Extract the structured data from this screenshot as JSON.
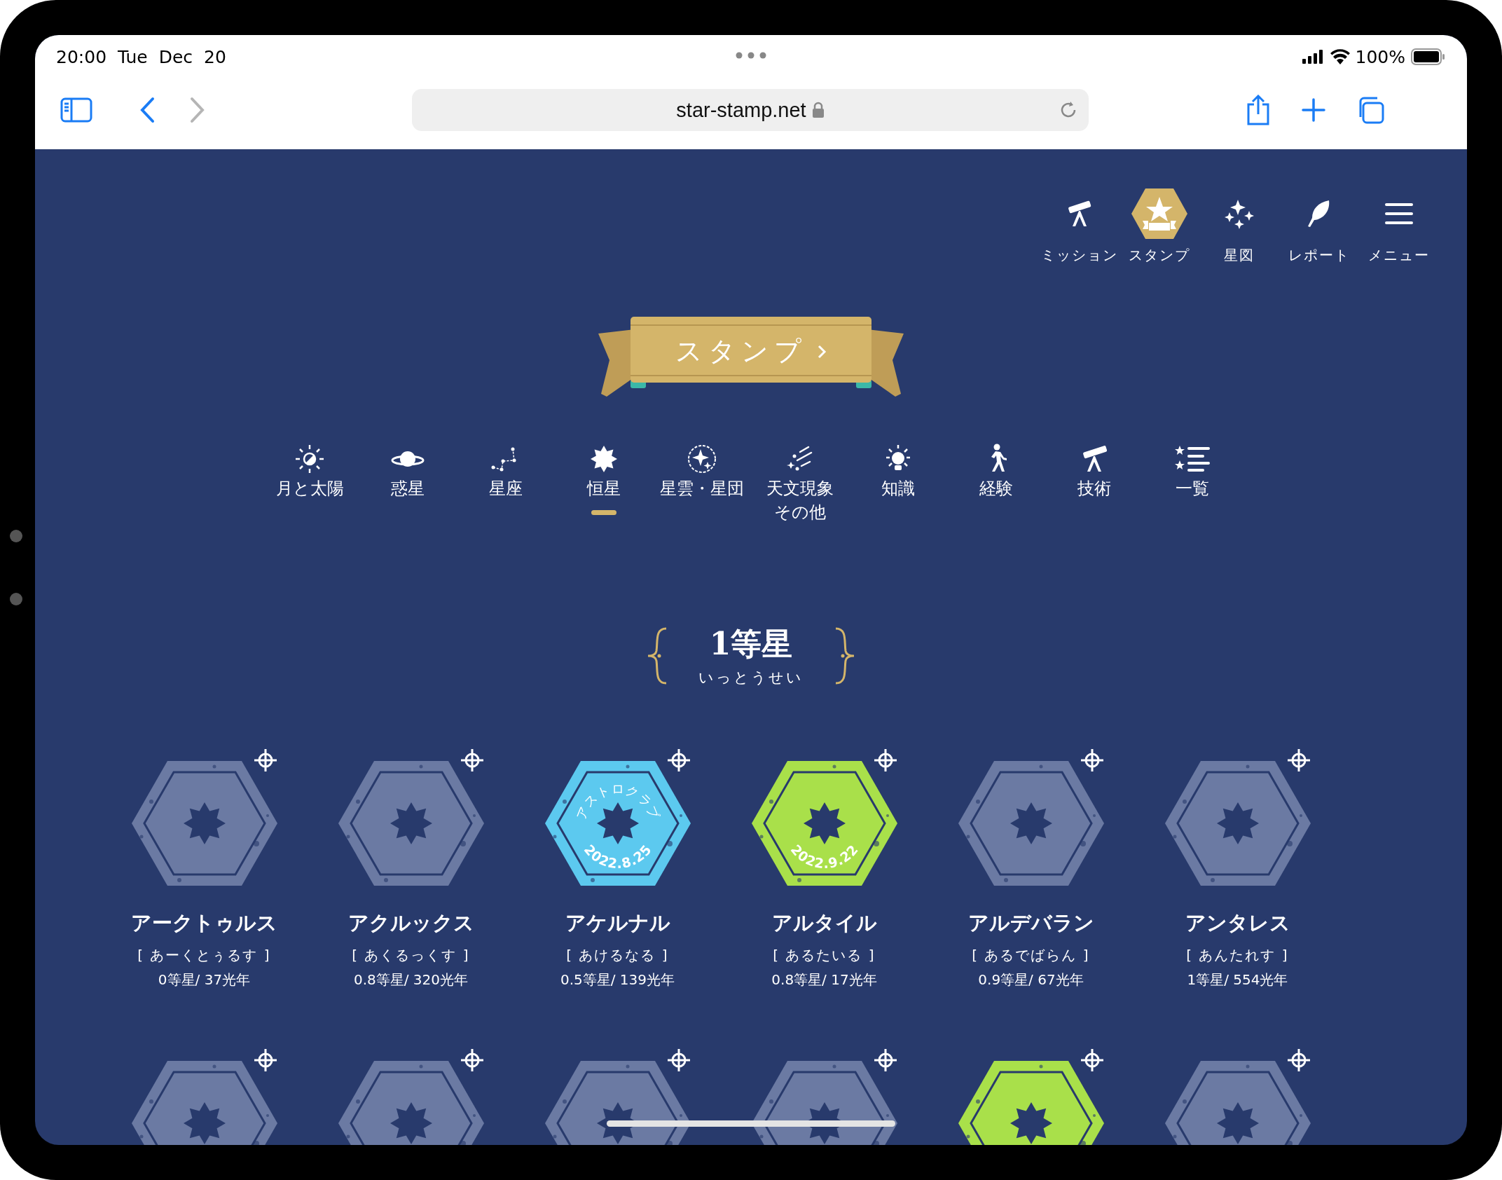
{
  "status_bar": {
    "time": "20:00",
    "date": "Tue Dec 20",
    "battery": "100%"
  },
  "browser": {
    "url": "star-stamp.net",
    "forward_enabled": false
  },
  "top_nav": [
    {
      "label": "ミッション",
      "selected": false
    },
    {
      "label": "スタンプ",
      "selected": true
    },
    {
      "label": "星図",
      "selected": false
    },
    {
      "label": "レポート",
      "selected": false
    },
    {
      "label": "メニュー",
      "selected": false
    }
  ],
  "banner": {
    "label": "スタンプ"
  },
  "categories": [
    {
      "lines": [
        "月と太陽"
      ],
      "selected": false
    },
    {
      "lines": [
        "惑星"
      ],
      "selected": false
    },
    {
      "lines": [
        "星座"
      ],
      "selected": false
    },
    {
      "lines": [
        "恒星"
      ],
      "selected": true
    },
    {
      "lines": [
        "星雲・星団"
      ],
      "selected": false
    },
    {
      "lines": [
        "天文現象",
        "その他"
      ],
      "selected": false
    },
    {
      "lines": [
        "知識"
      ],
      "selected": false
    },
    {
      "lines": [
        "経験"
      ],
      "selected": false
    },
    {
      "lines": [
        "技術"
      ],
      "selected": false
    },
    {
      "lines": [
        "一覧"
      ],
      "selected": false
    }
  ],
  "section": {
    "title": "1等星",
    "reading": "いっとうせい"
  },
  "stamps": [
    {
      "name": "アークトゥルス",
      "reading": "[ あーくとぅるす ]",
      "info": "0等星/ 37光年",
      "earned": false
    },
    {
      "name": "アクルックス",
      "reading": "[ あくるっくす ]",
      "info": "0.8等星/ 320光年",
      "earned": false
    },
    {
      "name": "アケルナル",
      "reading": "[ あけるなる ]",
      "info": "0.5等星/ 139光年",
      "earned": true,
      "color": "#5cc9ef",
      "arc_text": "アストロクラブ",
      "date": "2022.8.25"
    },
    {
      "name": "アルタイル",
      "reading": "[ あるたいる ]",
      "info": "0.8等星/ 17光年",
      "earned": true,
      "color": "#a9e04a",
      "date": "2022.9.22"
    },
    {
      "name": "アルデバラン",
      "reading": "[ あるでばらん ]",
      "info": "0.9等星/ 67光年",
      "earned": false
    },
    {
      "name": "アンタレス",
      "reading": "[ あんたれす ]",
      "info": "1等星/ 554光年",
      "earned": false
    },
    {
      "earned": false
    },
    {
      "earned": false
    },
    {
      "earned": false
    },
    {
      "earned": false
    },
    {
      "earned": true,
      "color": "#a9e04a"
    },
    {
      "earned": false
    }
  ]
}
